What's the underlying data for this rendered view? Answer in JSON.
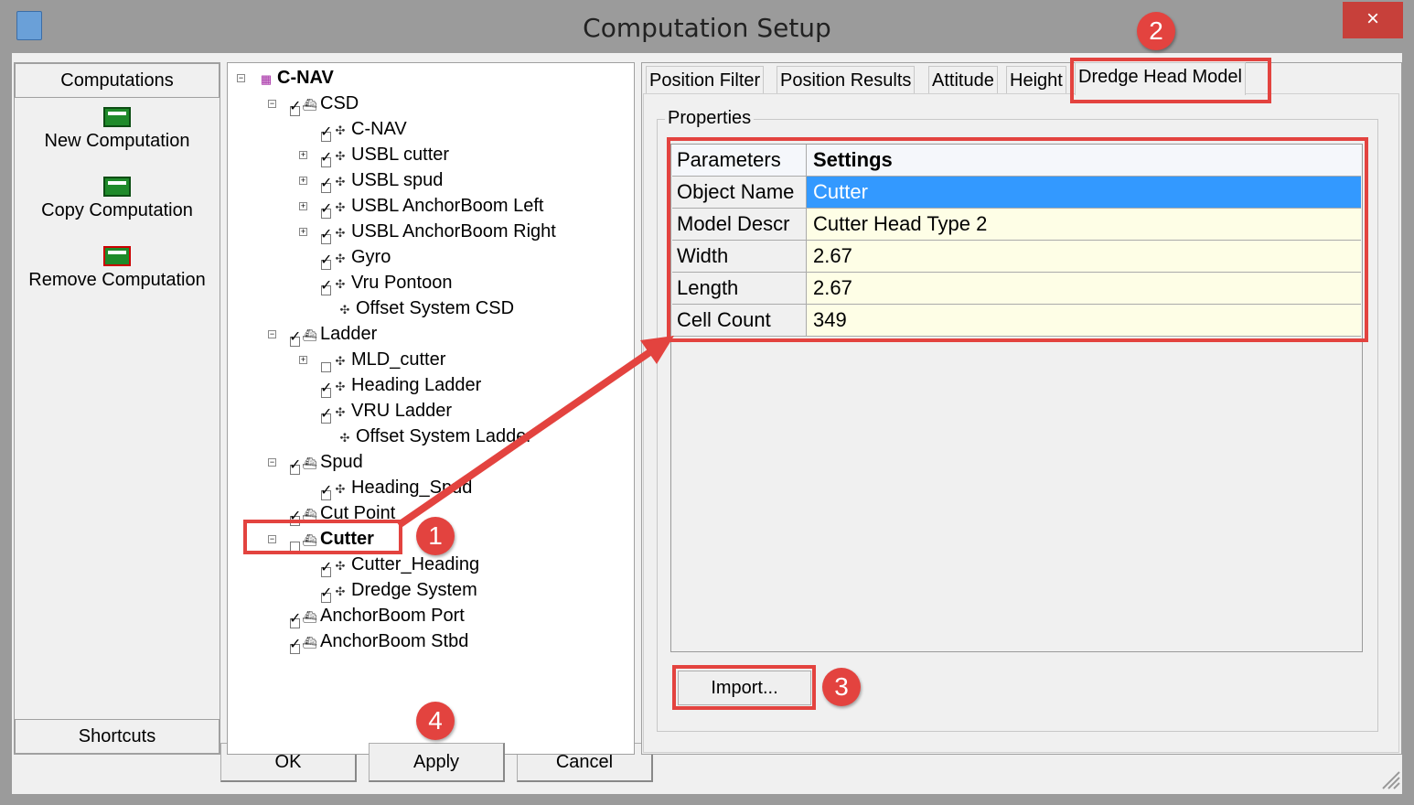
{
  "window": {
    "title": "Computation Setup",
    "close_icon": "×"
  },
  "left_panel": {
    "header": "Computations",
    "items": [
      {
        "label": "New Computation",
        "icon": "new-calculator-icon"
      },
      {
        "label": "Copy Computation",
        "icon": "copy-calculator-icon"
      },
      {
        "label": "Remove Computation",
        "icon": "remove-calculator-icon"
      }
    ],
    "footer": "Shortcuts"
  },
  "tree": [
    {
      "label": "C-NAV",
      "level": 0,
      "expander": "minus",
      "checkbox": "none",
      "bold": true
    },
    {
      "label": "CSD",
      "level": 1,
      "expander": "minus",
      "checkbox": "checked"
    },
    {
      "label": "C-NAV",
      "level": 2,
      "expander": "none",
      "checkbox": "checked"
    },
    {
      "label": "USBL cutter",
      "level": 2,
      "expander": "plus",
      "checkbox": "checked"
    },
    {
      "label": "USBL spud",
      "level": 2,
      "expander": "plus",
      "checkbox": "checked"
    },
    {
      "label": "USBL AnchorBoom Left",
      "level": 2,
      "expander": "plus",
      "checkbox": "checked"
    },
    {
      "label": "USBL AnchorBoom Right",
      "level": 2,
      "expander": "plus",
      "checkbox": "checked"
    },
    {
      "label": "Gyro",
      "level": 2,
      "expander": "none",
      "checkbox": "checked"
    },
    {
      "label": "Vru Pontoon",
      "level": 2,
      "expander": "none",
      "checkbox": "checked"
    },
    {
      "label": "Offset System CSD",
      "level": 2,
      "expander": "none",
      "checkbox": "none"
    },
    {
      "label": "Ladder",
      "level": 1,
      "expander": "minus",
      "checkbox": "checked"
    },
    {
      "label": "MLD_cutter",
      "level": 2,
      "expander": "plus",
      "checkbox": "unchecked"
    },
    {
      "label": "Heading Ladder",
      "level": 2,
      "expander": "none",
      "checkbox": "checked"
    },
    {
      "label": "VRU Ladder",
      "level": 2,
      "expander": "none",
      "checkbox": "checked"
    },
    {
      "label": "Offset System Ladder",
      "level": 2,
      "expander": "none",
      "checkbox": "none"
    },
    {
      "label": "Spud",
      "level": 1,
      "expander": "minus",
      "checkbox": "checked"
    },
    {
      "label": "Heading_Spud",
      "level": 2,
      "expander": "none",
      "checkbox": "checked"
    },
    {
      "label": "Cut Point",
      "level": 1,
      "expander": "none",
      "checkbox": "checked"
    },
    {
      "label": "Cutter",
      "level": 1,
      "expander": "minus",
      "checkbox": "unchecked",
      "bold": true
    },
    {
      "label": "Cutter_Heading",
      "level": 2,
      "expander": "none",
      "checkbox": "checked"
    },
    {
      "label": "Dredge System",
      "level": 2,
      "expander": "none",
      "checkbox": "checked"
    },
    {
      "label": "AnchorBoom Port",
      "level": 1,
      "expander": "none",
      "checkbox": "checked"
    },
    {
      "label": "AnchorBoom Stbd",
      "level": 1,
      "expander": "none",
      "checkbox": "checked"
    }
  ],
  "tabs": [
    {
      "label": "Position Filter"
    },
    {
      "label": "Position Results"
    },
    {
      "label": "Attitude"
    },
    {
      "label": "Height"
    },
    {
      "label": "Dredge Head Model",
      "active": true
    }
  ],
  "properties": {
    "group_label": "Properties",
    "header": {
      "param": "Parameters",
      "setting": "Settings"
    },
    "rows": [
      {
        "param": "Object Name",
        "setting": "Cutter",
        "selected": true
      },
      {
        "param": "Model Descr",
        "setting": "Cutter Head Type 2"
      },
      {
        "param": "Width",
        "setting": "2.67"
      },
      {
        "param": "Length",
        "setting": "2.67"
      },
      {
        "param": "Cell Count",
        "setting": "349"
      }
    ],
    "import_label": "Import..."
  },
  "buttons": {
    "ok": "OK",
    "apply": "Apply",
    "cancel": "Cancel"
  },
  "annotations": {
    "color": "#e3433f",
    "badges": [
      "1",
      "2",
      "3",
      "4"
    ]
  }
}
